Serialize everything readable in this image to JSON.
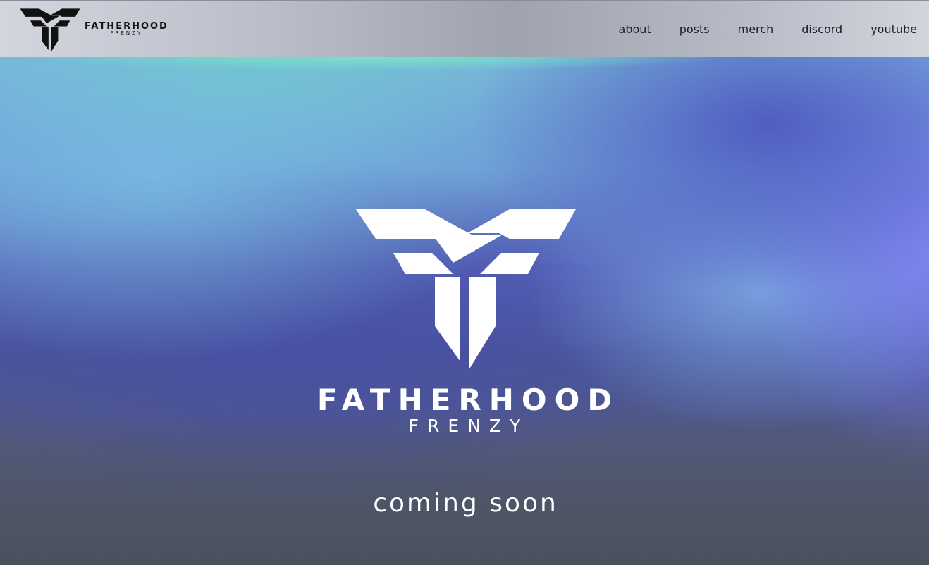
{
  "header": {
    "brand": {
      "icon": "fatherhood-frenzy-logo-icon",
      "title": "FATHERHOOD",
      "subtitle": "FRENZY"
    },
    "nav": [
      {
        "label": "about"
      },
      {
        "label": "posts"
      },
      {
        "label": "merch"
      },
      {
        "label": "discord"
      },
      {
        "label": "youtube"
      }
    ]
  },
  "hero": {
    "logo_icon": "fatherhood-frenzy-logo-icon",
    "title": "FATHERHOOD",
    "subtitle": "FRENZY",
    "status": "coming soon"
  },
  "colors": {
    "header_bg": "#b9bdc8",
    "nav_text": "#1d1f26",
    "hero_text": "#ffffff",
    "logo_dark": "#111111",
    "logo_light": "#ffffff"
  }
}
